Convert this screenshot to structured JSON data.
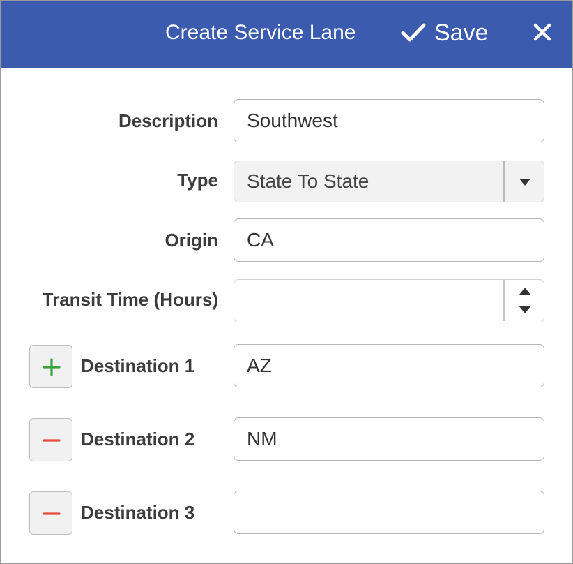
{
  "header": {
    "title": "Create Service Lane",
    "save_label": "Save",
    "save_icon": "checkmark-icon",
    "close_icon": "close-icon"
  },
  "form": {
    "description": {
      "label": "Description",
      "value": "Southwest"
    },
    "type": {
      "label": "Type",
      "value": "State To State"
    },
    "origin": {
      "label": "Origin",
      "value": "CA"
    },
    "transit_time": {
      "label": "Transit Time (Hours)",
      "value": ""
    },
    "destinations": [
      {
        "label": "Destination 1",
        "value": "AZ",
        "action": "add"
      },
      {
        "label": "Destination 2",
        "value": "NM",
        "action": "remove"
      },
      {
        "label": "Destination 3",
        "value": "",
        "action": "remove"
      }
    ]
  },
  "colors": {
    "header_bg": "#3b5bae",
    "add_green": "#3aa43c",
    "remove_red": "#e34a3a"
  }
}
